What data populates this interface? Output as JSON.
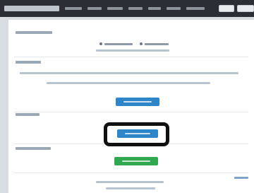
{
  "colors": {
    "topbar": "#2b2f35",
    "primary_button": "#2e86c9",
    "secondary_button": "#2fa84f",
    "highlight_frame": "#111111",
    "page_background": "#ffffff"
  },
  "icons": {
    "radio": "radio-dot-icon"
  },
  "note": ""
}
